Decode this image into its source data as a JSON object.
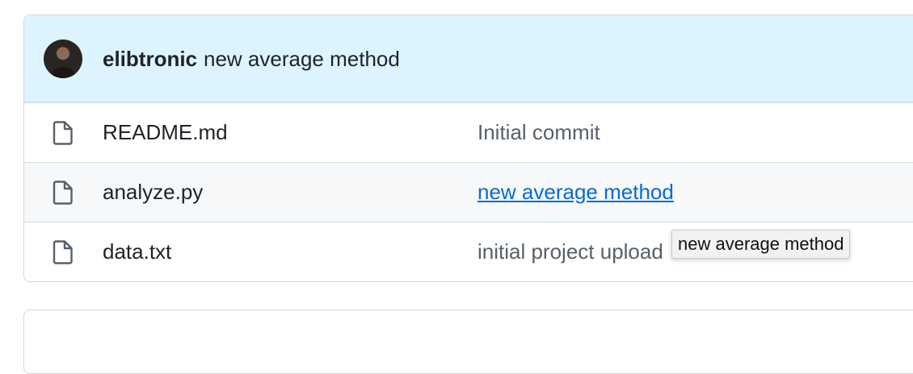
{
  "commit": {
    "author": "elibtronic",
    "message": "new average method"
  },
  "files": [
    {
      "name": "README.md",
      "last_commit": "Initial commit",
      "row_style": "plain",
      "hovered": false
    },
    {
      "name": "analyze.py",
      "last_commit": "new average method",
      "row_style": "alt",
      "hovered": true
    },
    {
      "name": "data.txt",
      "last_commit": "initial project upload",
      "row_style": "plain",
      "hovered": false
    }
  ],
  "tooltip": {
    "text": "new average method"
  },
  "colors": {
    "header_bg": "#ddf4ff",
    "link": "#0969da",
    "muted_text": "#57606a",
    "border": "#d0d7de"
  },
  "icons": {
    "file": "file-icon",
    "avatar": "avatar"
  }
}
